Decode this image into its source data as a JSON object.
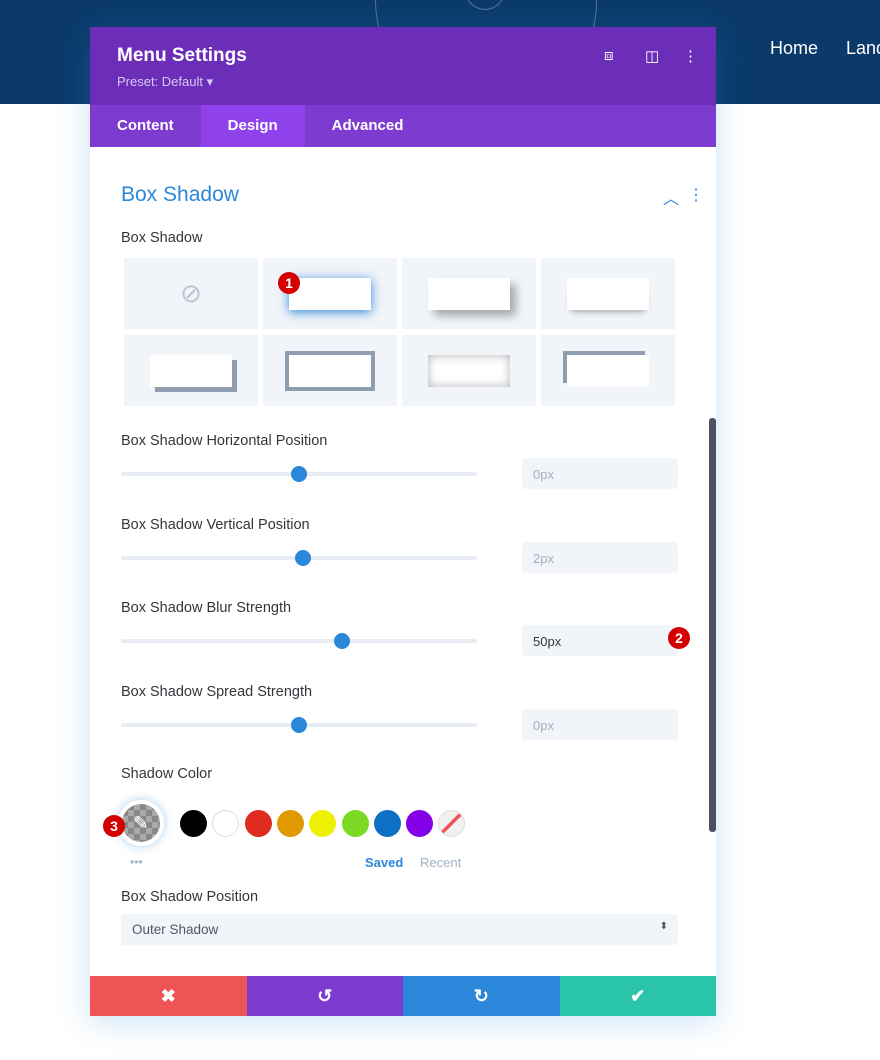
{
  "site": {
    "nav": [
      "Home",
      "Landing"
    ]
  },
  "modal": {
    "title": "Menu Settings",
    "preset": "Preset: Default ▾",
    "tabs": [
      "Content",
      "Design",
      "Advanced"
    ],
    "active_tab": "Design",
    "section": "Box Shadow",
    "box_shadow_label": "Box Shadow",
    "selected_preset": 1,
    "sliders": [
      {
        "label": "Box Shadow Horizontal Position",
        "value": "0px",
        "fraction": 0.5
      },
      {
        "label": "Box Shadow Vertical Position",
        "value": "2px",
        "fraction": 0.51
      },
      {
        "label": "Box Shadow Blur Strength",
        "value": "50px",
        "fraction": 0.62
      },
      {
        "label": "Box Shadow Spread Strength",
        "value": "0px",
        "fraction": 0.5
      }
    ],
    "shadow_color_label": "Shadow Color",
    "swatches": [
      "#000000",
      "#ffffff",
      "#e02b20",
      "#e09900",
      "#edf000",
      "#7cda24",
      "#0c71c3",
      "#8300e9"
    ],
    "saved": "Saved",
    "recent": "Recent",
    "more": "•••",
    "position_label": "Box Shadow Position",
    "position_value": "Outer Shadow",
    "badges": [
      "1",
      "2",
      "3"
    ],
    "footer": {
      "cancel": "✖",
      "undo": "↺",
      "redo": "↻",
      "save": "✔"
    },
    "colors": {
      "header": "#6c2eb9",
      "tabs": "#7e3bd0",
      "accent": "#2b87da",
      "cancel": "#ef5555",
      "save": "#29c4a9"
    }
  }
}
